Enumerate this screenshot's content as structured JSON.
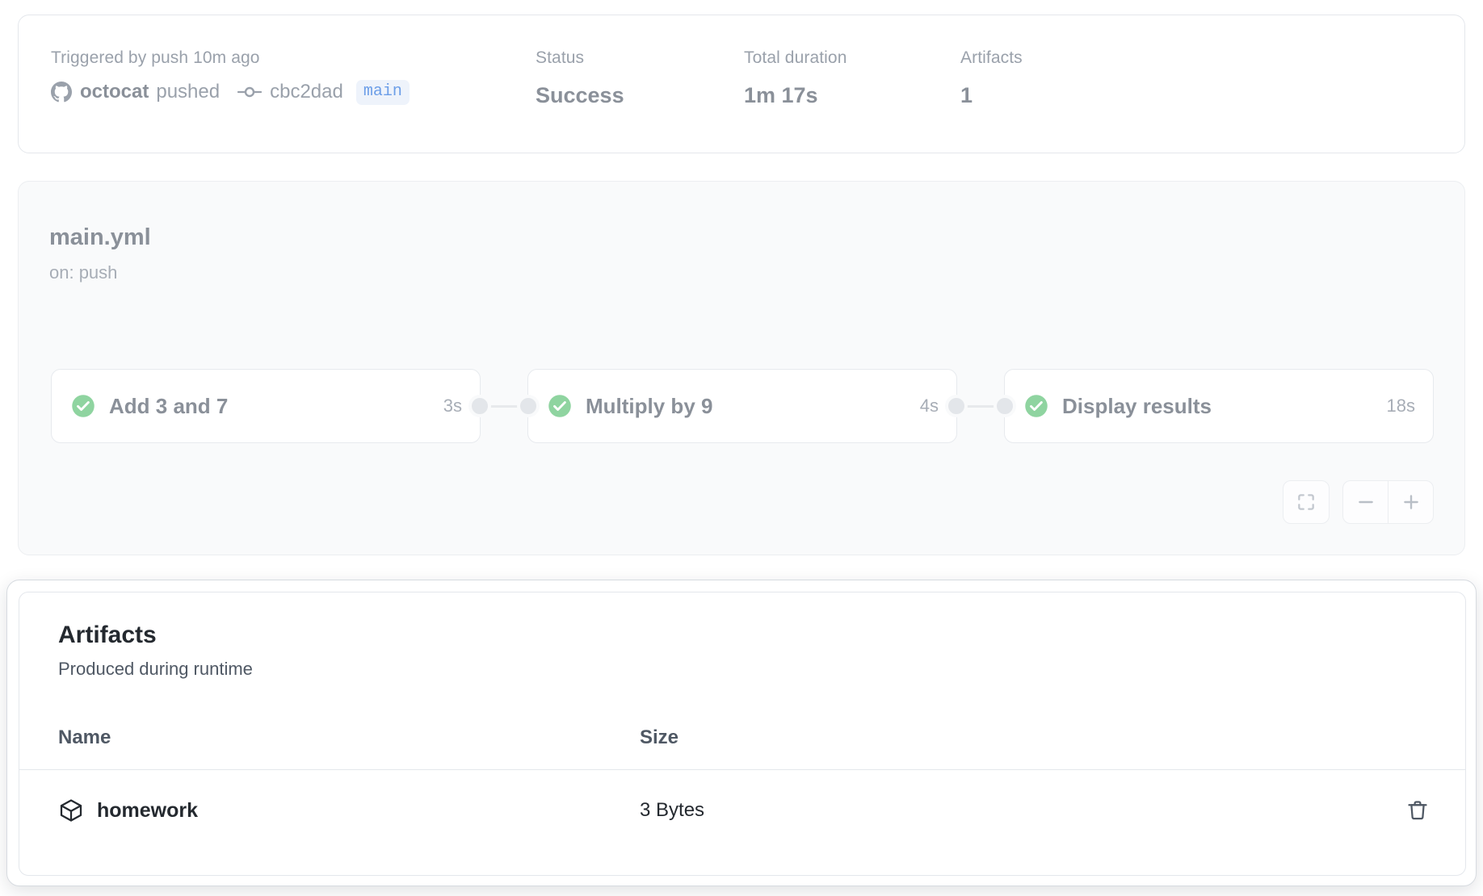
{
  "summary": {
    "trigger_label": "Triggered by push 10m ago",
    "actor": "octocat",
    "action": "pushed",
    "commit_sha": "cbc2dad",
    "branch": "main",
    "status_label": "Status",
    "status_value": "Success",
    "duration_label": "Total duration",
    "duration_value": "1m 17s",
    "artifacts_label": "Artifacts",
    "artifacts_value": "1"
  },
  "workflow": {
    "name": "main.yml",
    "trigger": "on: push",
    "jobs": [
      {
        "name": "Add 3 and 7",
        "duration": "3s",
        "status": "success"
      },
      {
        "name": "Multiply by 9",
        "duration": "4s",
        "status": "success"
      },
      {
        "name": "Display results",
        "duration": "18s",
        "status": "success"
      }
    ],
    "controls": {
      "fit": "fit-to-screen",
      "zoom_out": "−",
      "zoom_in": "+"
    }
  },
  "artifacts": {
    "title": "Artifacts",
    "subtitle": "Produced during runtime",
    "columns": {
      "name": "Name",
      "size": "Size"
    },
    "rows": [
      {
        "name": "homework",
        "size": "3 Bytes",
        "delete_label": "Delete artifact"
      }
    ]
  },
  "colors": {
    "success_green": "#8fd4a0",
    "branch_blue": "#6c9ee8",
    "branch_bg": "#eef3fb",
    "muted_text": "#9aa1ab",
    "dark_text": "#24292f"
  }
}
